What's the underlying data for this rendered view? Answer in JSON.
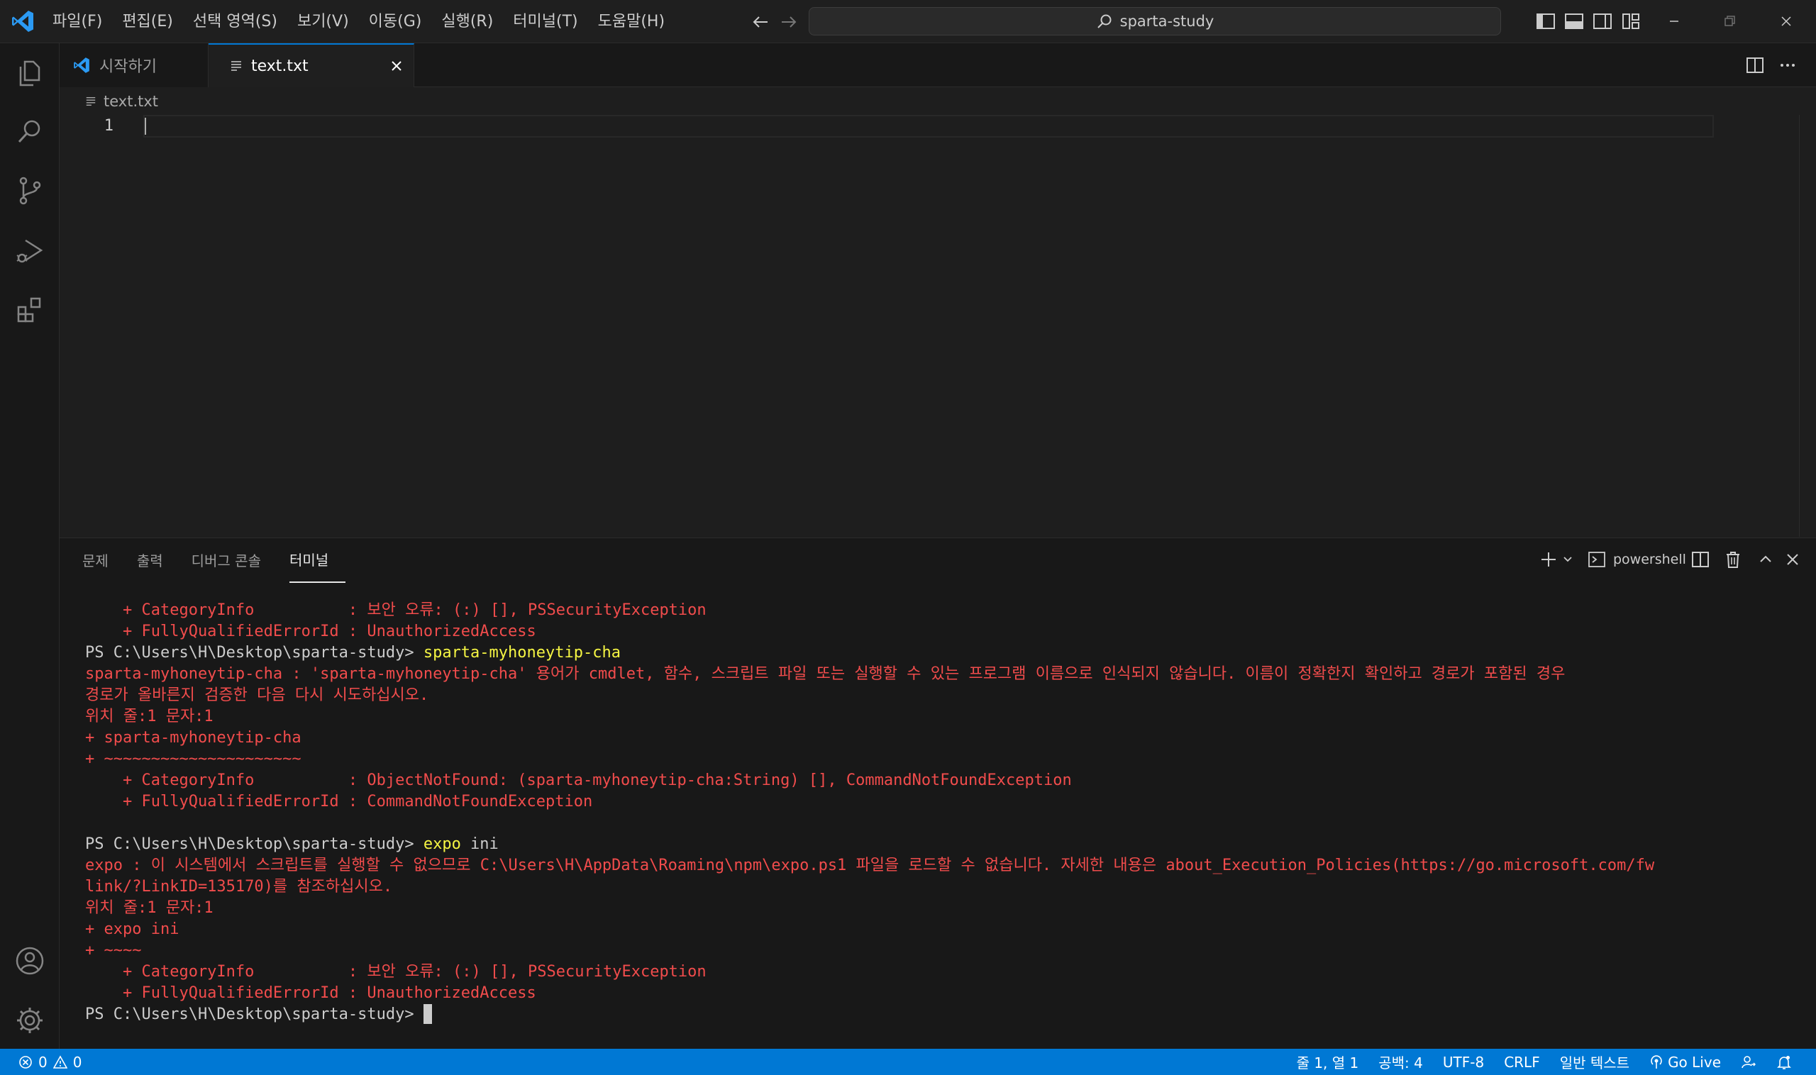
{
  "titlebar": {
    "menu": [
      "파일(F)",
      "편집(E)",
      "선택 영역(S)",
      "보기(V)",
      "이동(G)",
      "실행(R)",
      "터미널(T)",
      "도움말(H)"
    ],
    "search_text": "sparta-study"
  },
  "tabs": [
    {
      "label": "시작하기",
      "active": false
    },
    {
      "label": "text.txt",
      "active": true
    }
  ],
  "editor": {
    "breadcrumb": "text.txt",
    "line_number": "1"
  },
  "panel": {
    "tabs": [
      "문제",
      "출력",
      "디버그 콘솔",
      "터미널"
    ],
    "active_tab": "터미널",
    "terminal_profile": "powershell"
  },
  "terminal": {
    "lines": [
      {
        "t": "err",
        "text": "    + CategoryInfo          : 보안 오류: (:) [], PSSecurityException"
      },
      {
        "t": "err",
        "text": "    + FullyQualifiedErrorId : UnauthorizedAccess"
      },
      {
        "t": "prompt",
        "prompt": "PS C:\\Users\\H\\Desktop\\sparta-study> ",
        "cmd": "sparta-myhoneytip-cha"
      },
      {
        "t": "err",
        "text": "sparta-myhoneytip-cha : 'sparta-myhoneytip-cha' 용어가 cmdlet, 함수, 스크립트 파일 또는 실행할 수 있는 프로그램 이름으로 인식되지 않습니다. 이름이 정확한지 확인하고 경로가 포함된 경우"
      },
      {
        "t": "err",
        "text": "경로가 올바른지 검증한 다음 다시 시도하십시오."
      },
      {
        "t": "err",
        "text": "위치 줄:1 문자:1"
      },
      {
        "t": "err",
        "text": "+ sparta-myhoneytip-cha"
      },
      {
        "t": "err",
        "text": "+ ~~~~~~~~~~~~~~~~~~~~~"
      },
      {
        "t": "err",
        "text": "    + CategoryInfo          : ObjectNotFound: (sparta-myhoneytip-cha:String) [], CommandNotFoundException"
      },
      {
        "t": "err",
        "text": "    + FullyQualifiedErrorId : CommandNotFoundException"
      },
      {
        "t": "blank",
        "text": ""
      },
      {
        "t": "prompt",
        "prompt": "PS C:\\Users\\H\\Desktop\\sparta-study> ",
        "cmd": "expo",
        "args": " ini"
      },
      {
        "t": "err",
        "text": "expo : 이 시스템에서 스크립트를 실행할 수 없으므로 C:\\Users\\H\\AppData\\Roaming\\npm\\expo.ps1 파일을 로드할 수 없습니다. 자세한 내용은 about_Execution_Policies(https://go.microsoft.com/fw"
      },
      {
        "t": "err",
        "text": "link/?LinkID=135170)를 참조하십시오."
      },
      {
        "t": "err",
        "text": "위치 줄:1 문자:1"
      },
      {
        "t": "err",
        "text": "+ expo ini"
      },
      {
        "t": "err",
        "text": "+ ~~~~"
      },
      {
        "t": "err",
        "text": "    + CategoryInfo          : 보안 오류: (:) [], PSSecurityException"
      },
      {
        "t": "err",
        "text": "    + FullyQualifiedErrorId : UnauthorizedAccess"
      },
      {
        "t": "prompt",
        "prompt": "PS C:\\Users\\H\\Desktop\\sparta-study> ",
        "cmd": "",
        "cursor": true
      }
    ]
  },
  "statusbar": {
    "errors": "0",
    "warnings": "0",
    "position": "줄 1, 열 1",
    "indent": "공백: 4",
    "encoding": "UTF-8",
    "eol": "CRLF",
    "language": "일반 텍스트",
    "golive": "Go Live"
  },
  "colors": {
    "accent": "#0078d4",
    "error_text": "#f14c4c",
    "command_text": "#f5f543"
  }
}
